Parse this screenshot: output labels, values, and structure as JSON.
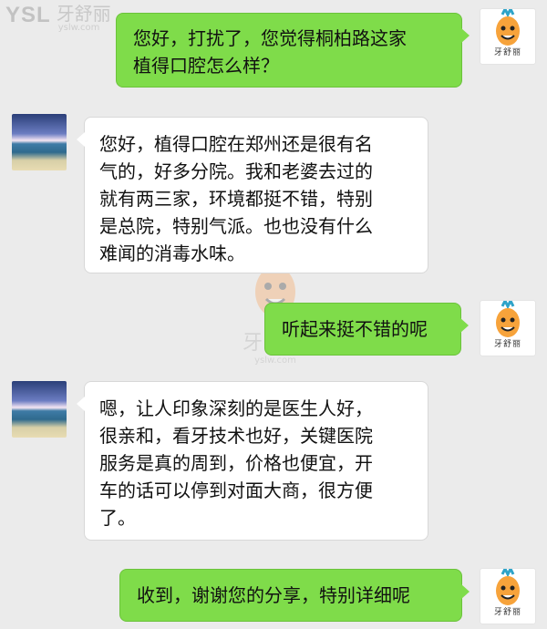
{
  "brand": {
    "logo_mark": "YSL",
    "logo_cn": "牙舒丽",
    "logo_url": "yslw.com",
    "watermark_text": "牙舒丽",
    "watermark_url": "yslw.com",
    "avatar_caption": "牙舒丽"
  },
  "chat": {
    "messages": [
      {
        "side": "right",
        "text": "您好，打扰了，您觉得桐柏路这家\n植得口腔怎么样？"
      },
      {
        "side": "left",
        "text": "您好，植得口腔在郑州还是很有名\n气的，好多分院。我和老婆去过的\n就有两三家，环境都挺不错，特别\n是总院，特别气派。也也没有什么\n难闻的消毒水味。"
      },
      {
        "side": "right",
        "text": "听起来挺不错的呢"
      },
      {
        "side": "left",
        "text": "嗯，让人印象深刻的是医生人好，\n很亲和，看牙技术也好，关键医院\n服务是真的周到，价格也便宜，开\n车的话可以停到对面大商，很方便\n了。"
      },
      {
        "side": "right",
        "text": "收到，谢谢您的分享，特别详细呢"
      }
    ]
  },
  "colors": {
    "background": "#ebebeb",
    "sent_bubble": "#7fdc4a",
    "received_bubble": "#ffffff"
  }
}
